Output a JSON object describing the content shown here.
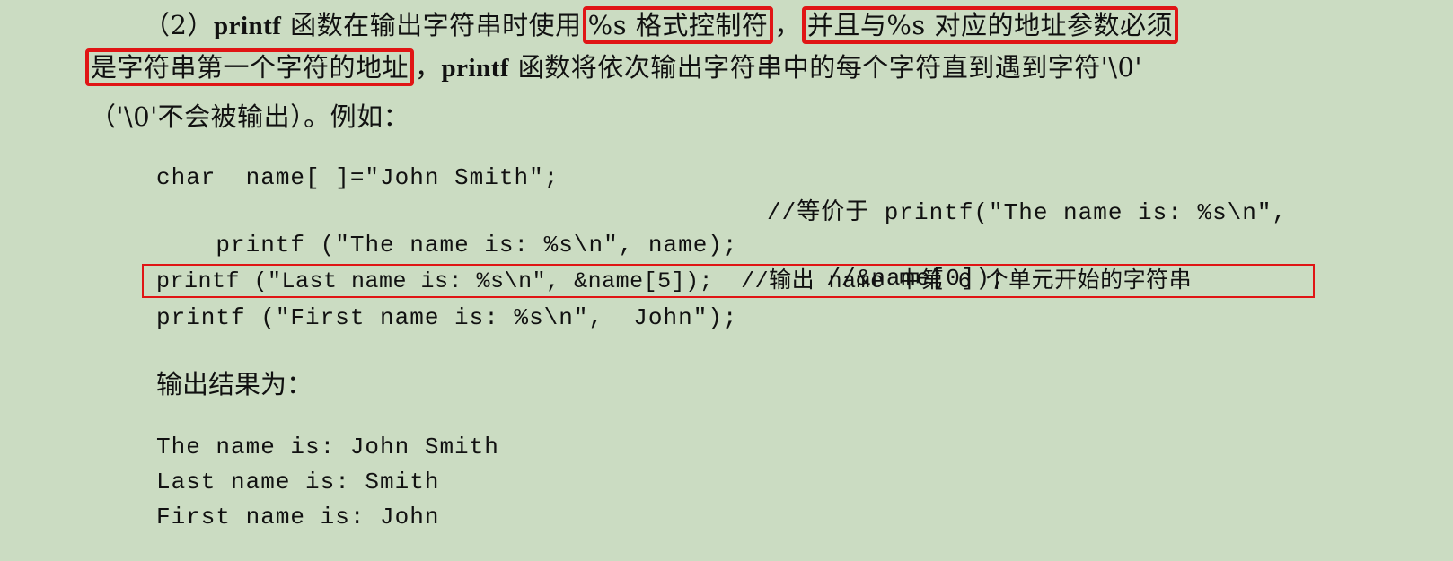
{
  "paragraph": {
    "line1": {
      "lead": "（2）",
      "fn": "printf",
      "text1": " 函数在输出字符串时使用",
      "hl1": "%s 格式控制符",
      "comma": "，",
      "hl2": "并且与%s 对应的地址参数必须"
    },
    "line2": {
      "hl3": "是字符串第一个字符的地址",
      "text1": "，",
      "fn": "printf",
      "text2": " 函数将依次输出字符串中的每个字符直到遇到字符'\\0'"
    },
    "line3": {
      "text": "（'\\0'不会被输出）。例如："
    }
  },
  "code": {
    "line1": "char  name[ ]=\"John Smith\";",
    "line2": "printf (\"The name is: %s\\n\", name);",
    "line2_comment": "//等价于 printf(\"The name is: %s\\n\",",
    "line3_comment": "//&name[0]);",
    "line4": "printf (\"Last name is: %s\\n\", &name[5]);  //输出 name 中第 6 个单元开始的字符串",
    "line5": "printf (\"First name is: %s\\n\",  John\");"
  },
  "output_heading": "输出结果为：",
  "output": {
    "line1": "The name is: John Smith",
    "line2": "Last name is: Smith",
    "line3": "First name is: John"
  },
  "colors": {
    "background": "#cbdcc2",
    "highlight": "#e01515",
    "text": "#111111"
  }
}
